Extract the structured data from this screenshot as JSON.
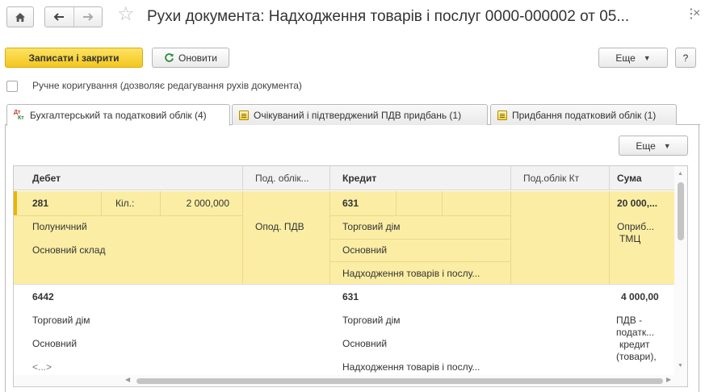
{
  "window": {
    "title": "Рухи документа: Надходження товарів і послуг 0000-000002 от 05...",
    "more_glyph": "⋮",
    "close_glyph": "×"
  },
  "toolbar": {
    "save_close_label": "Записати і закрити",
    "refresh_label": "Оновити",
    "more_label": "Еще",
    "help_label": "?"
  },
  "manual_edit": {
    "checked": false,
    "label": "Ручне коригування (дозволяє редагування рухів документа)"
  },
  "tabs": [
    {
      "label": "Бухгалтерський та податковий облік (4)",
      "icon": "dt-kt-icon",
      "active": true
    },
    {
      "label": "Очікуваний і підтверджений ПДВ придбань (1)",
      "icon": "register-icon",
      "active": false
    },
    {
      "label": "Придбання податковий облік (1)",
      "icon": "register-icon",
      "active": false
    }
  ],
  "grid_toolbar": {
    "more_label": "Еще"
  },
  "grid": {
    "columns": {
      "debit": "Дебет",
      "debit_tax": "Под. облік...",
      "credit": "Кредит",
      "credit_tax": "Под.облік Кт",
      "sum": "Сума"
    },
    "rows": [
      {
        "debit_account": "281",
        "qty_label": "Кіл.:",
        "qty_value": "2 000,000",
        "debit_sub1": "Полуничний",
        "debit_sub2": "Основний склад",
        "debit_sub3": "",
        "debit_tax": "Опод. ПДВ",
        "credit_account": "631",
        "credit_sub1": "Торговий дім",
        "credit_sub2": "Основний",
        "credit_sub3": "Надходження товарів і послу...",
        "sum": "20 000,...",
        "content_line1": "Оприб...",
        "content_line2": "ТМЦ",
        "content_line3": "",
        "content_line4": ""
      },
      {
        "debit_account": "6442",
        "debit_sub1": "Торговий дім",
        "debit_sub2": "Основний",
        "debit_sub3": "<...>",
        "credit_account": "631",
        "credit_sub1": "Торговий дім",
        "credit_sub2": "Основний",
        "credit_sub3": "Надходження товарів і послу...",
        "sum": "4 000,00",
        "content_line1": "ПДВ -",
        "content_line2": "податк...",
        "content_line3": "кредит",
        "content_line4": "(товари),"
      }
    ]
  }
}
